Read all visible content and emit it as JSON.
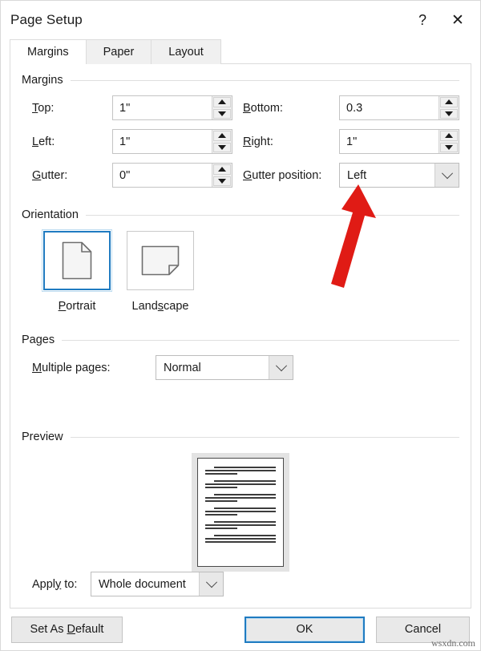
{
  "window": {
    "title": "Page Setup",
    "help_icon": "question-mark-icon",
    "help_label": "?",
    "close_icon": "close-icon",
    "close_label": "✕"
  },
  "tabs": [
    {
      "label": "Margins",
      "active": true
    },
    {
      "label": "Paper",
      "active": false
    },
    {
      "label": "Layout",
      "active": false
    }
  ],
  "margins_group": {
    "title": "Margins",
    "fields": [
      {
        "label": "Top:",
        "accel": "T",
        "value": "1\""
      },
      {
        "label": "Bottom:",
        "accel": "B",
        "value": "0.3"
      },
      {
        "label": "Left:",
        "accel": "L",
        "value": "1\""
      },
      {
        "label": "Right:",
        "accel": "R",
        "value": "1\""
      },
      {
        "label": "Gutter:",
        "accel": "G",
        "value": "0\""
      }
    ],
    "gutter_position": {
      "label": "Gutter position:",
      "value": "Left"
    }
  },
  "orientation_group": {
    "title": "Orientation",
    "options": [
      {
        "label": "Portrait",
        "selected": true
      },
      {
        "label": "Landscape",
        "selected": false
      }
    ]
  },
  "pages_group": {
    "title": "Pages",
    "multiple_pages": {
      "label": "Multiple pages:",
      "value": "Normal"
    }
  },
  "preview_group": {
    "title": "Preview"
  },
  "apply_to": {
    "label": "Apply to:",
    "value": "Whole document"
  },
  "footer": {
    "set_as_default": "Set As Default",
    "ok": "OK",
    "cancel": "Cancel"
  },
  "watermark": "wsxdn.com",
  "colors": {
    "accent_blue": "#1f7bc1",
    "annotation_red": "#e01b15",
    "panel_border": "#dcdcdc",
    "field_border": "#c4c4c4"
  }
}
